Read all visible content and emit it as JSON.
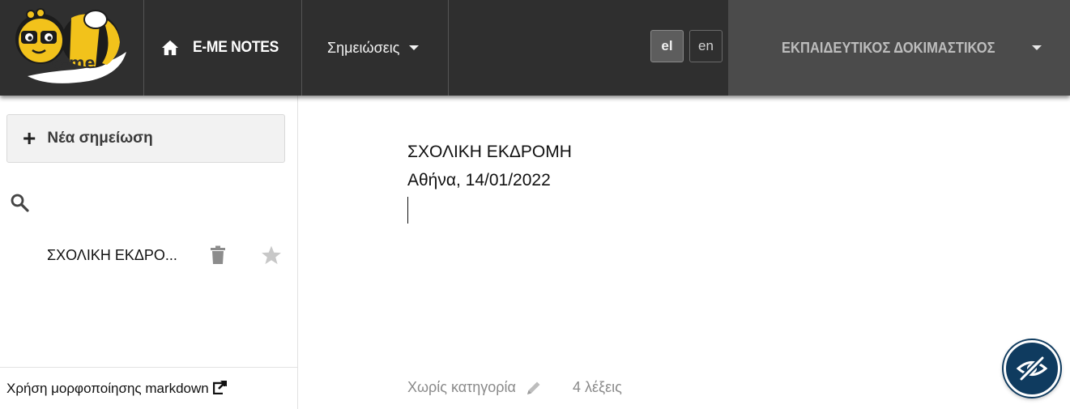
{
  "header": {
    "logo_text": "e-me",
    "app_title": "E-ME NOTES",
    "notes_menu_label": "Σημειώσεις",
    "languages": [
      {
        "code": "el",
        "active": true
      },
      {
        "code": "en",
        "active": false
      }
    ],
    "user_name": "ΕΚΠΑΙΔΕΥΤΙΚΟΣ ΔΟΚΙΜΑΣΤΙΚΟΣ"
  },
  "sidebar": {
    "new_note_label": "Νέα σημείωση",
    "notes": [
      {
        "title": "ΣΧΟΛΙΚΗ ΕΚΔΡΟ...",
        "starred": false
      }
    ],
    "footer_link": "Χρήση μορφοποίησης markdown"
  },
  "editor": {
    "lines": [
      "ΣΧΟΛΙΚΗ ΕΚΔΡΟΜΗ",
      "Αθήνα, 14/01/2022"
    ],
    "category": "Χωρίς κατηγορία",
    "word_count": "4 λέξεις"
  },
  "colors": {
    "topbar": "#2f2f2f",
    "user_panel": "#4b4b4b",
    "logo_yellow": "#f2c21b",
    "accessibility_button": "#0f3b5f"
  },
  "icons": [
    "home-icon",
    "chevron-down-icon",
    "plus-icon",
    "search-icon",
    "trash-icon",
    "star-icon",
    "external-link-icon",
    "pencil-icon",
    "eye-slash-icon"
  ]
}
